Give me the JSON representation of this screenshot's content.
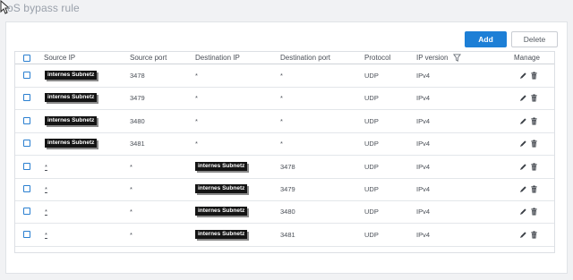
{
  "page": {
    "title": "oS bypass rule"
  },
  "toolbar": {
    "add_label": "Add",
    "delete_label": "Delete"
  },
  "table": {
    "columns": [
      "Source IP",
      "Source port",
      "Destination IP",
      "Destination port",
      "Protocol",
      "IP version",
      "Manage"
    ],
    "rows": [
      {
        "source_ip": "internes Subnetz",
        "source_port": "3478",
        "destination_ip": "*",
        "destination_port": "*",
        "protocol": "UDP",
        "ip_version": "IPv4"
      },
      {
        "source_ip": "internes Subnetz",
        "source_port": "3479",
        "destination_ip": "*",
        "destination_port": "*",
        "protocol": "UDP",
        "ip_version": "IPv4"
      },
      {
        "source_ip": "internes Subnetz",
        "source_port": "3480",
        "destination_ip": "*",
        "destination_port": "*",
        "protocol": "UDP",
        "ip_version": "IPv4"
      },
      {
        "source_ip": "internes Subnetz",
        "source_port": "3481",
        "destination_ip": "*",
        "destination_port": "*",
        "protocol": "UDP",
        "ip_version": "IPv4"
      },
      {
        "source_ip": "*",
        "source_port": "*",
        "destination_ip": "internes Subnetz",
        "destination_port": "3478",
        "protocol": "UDP",
        "ip_version": "IPv4"
      },
      {
        "source_ip": "*",
        "source_port": "*",
        "destination_ip": "internes Subnetz",
        "destination_port": "3479",
        "protocol": "UDP",
        "ip_version": "IPv4"
      },
      {
        "source_ip": "*",
        "source_port": "*",
        "destination_ip": "internes Subnetz",
        "destination_port": "3480",
        "protocol": "UDP",
        "ip_version": "IPv4"
      },
      {
        "source_ip": "*",
        "source_port": "*",
        "destination_ip": "internes Subnetz",
        "destination_port": "3481",
        "protocol": "UDP",
        "ip_version": "IPv4"
      }
    ]
  },
  "icons": {
    "filter": "filter-icon",
    "edit": "pencil-icon",
    "delete": "trash-icon",
    "cursor": "mouse-pointer-icon"
  },
  "colors": {
    "accent": "#1d7fd6",
    "tag_background": "#141414"
  }
}
